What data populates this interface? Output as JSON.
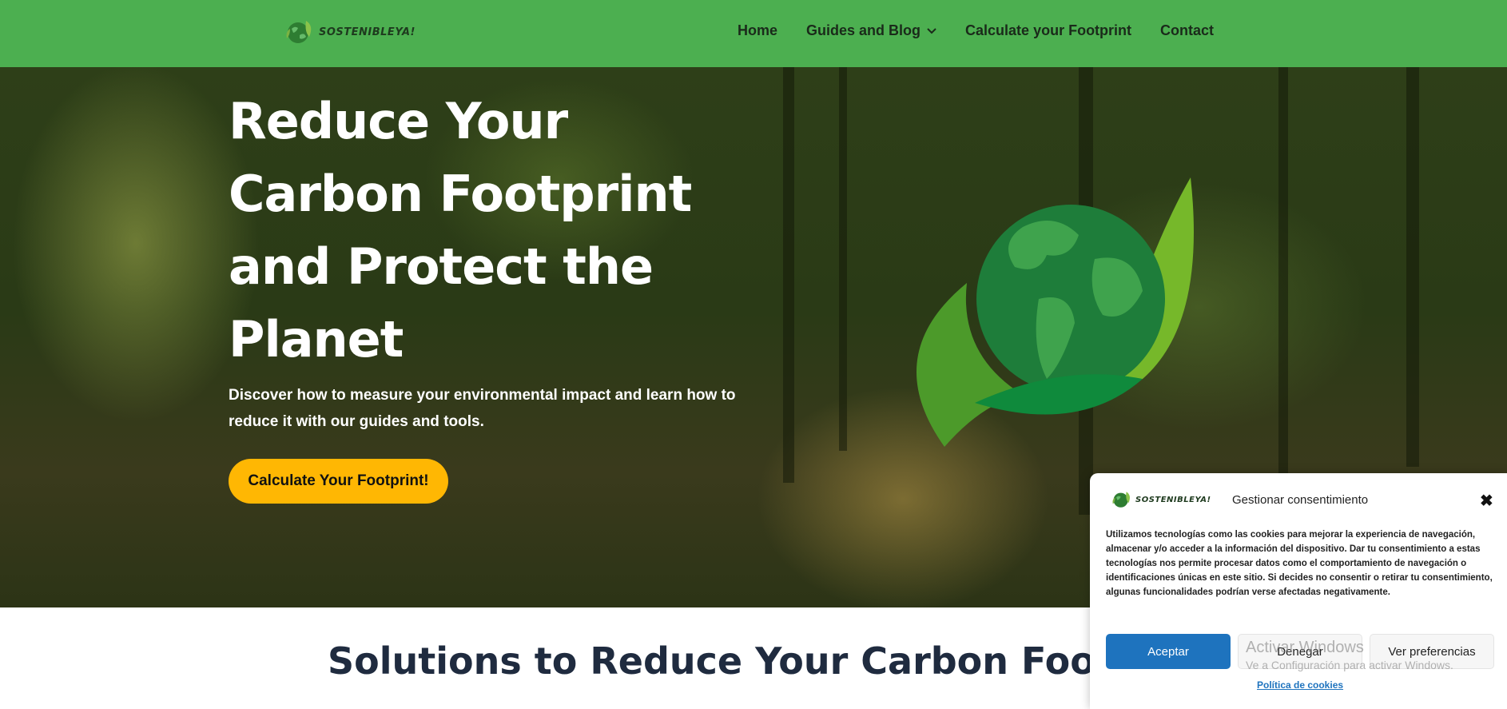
{
  "brand": {
    "name": "SOSTENIBLEYA!",
    "logo_icon": "globe-leaf-icon"
  },
  "nav": {
    "home": "Home",
    "guides": "Guides and Blog",
    "calculate": "Calculate your Footprint",
    "contact": "Contact"
  },
  "hero": {
    "title": "Reduce Your Carbon Footprint and Protect the Planet",
    "subtitle": "Discover how to measure your environmental impact and learn how to reduce it with our guides and tools.",
    "cta": "Calculate Your Footprint!"
  },
  "section": {
    "title": "Solutions to Reduce Your Carbon Foot"
  },
  "consent": {
    "title": "Gestionar consentimiento",
    "body": "Utilizamos tecnologías como las cookies para mejorar la experiencia de navegación, almacenar y/o acceder a la información del dispositivo. Dar tu consentimiento a estas tecnologías nos permite procesar datos como el comportamiento de navegación o identificaciones únicas en este sitio. Si decides no consentir o retirar tu consentimiento, algunas funcionalidades podrían verse afectadas negativamente.",
    "accept": "Aceptar",
    "deny": "Denegar",
    "preferences": "Ver preferencias",
    "policy": "Política de cookies",
    "close_symbol": "✖"
  },
  "watermark": {
    "title": "Activar Windows",
    "subtitle": "Ve a Configuración para activar Windows."
  },
  "colors": {
    "header": "#4caf50",
    "cta": "#ffb703",
    "accept": "#1e73be",
    "section_title": "#1f2b3f"
  }
}
